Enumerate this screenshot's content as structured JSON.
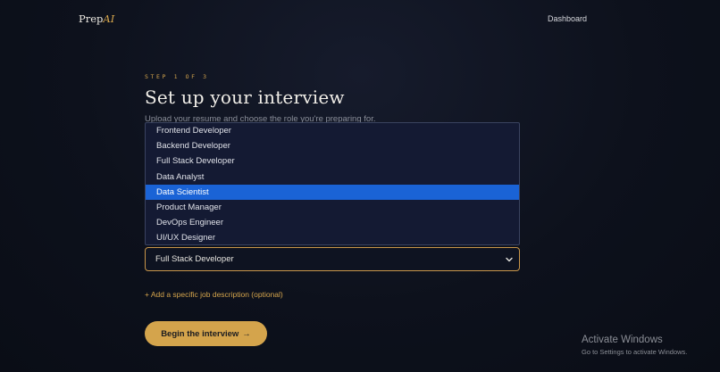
{
  "brand": {
    "name": "Prep",
    "accent": "AI"
  },
  "nav": {
    "dashboard": "Dashboard"
  },
  "step_label": "STEP 1 OF 3",
  "title": "Set up your interview",
  "subtitle": "Upload your resume and choose the role you're preparing for.",
  "role_select": {
    "value": "Full Stack Developer",
    "options": [
      "Frontend Developer",
      "Backend Developer",
      "Full Stack Developer",
      "Data Analyst",
      "Data Scientist",
      "Product Manager",
      "DevOps Engineer",
      "UI/UX Designer"
    ],
    "highlighted": "Data Scientist"
  },
  "job_description_link": "+ Add a specific job description (optional)",
  "begin_button": {
    "label": "Begin the interview",
    "arrow": "→"
  },
  "watermark": {
    "line1": "Activate Windows",
    "line2": "Go to Settings to activate Windows."
  },
  "colors": {
    "accent": "#d4a44c",
    "highlight": "#1a63d6",
    "background": "#0d111c"
  }
}
